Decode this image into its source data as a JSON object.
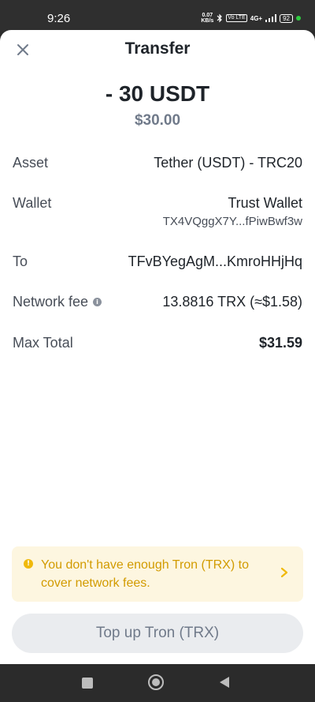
{
  "status_bar": {
    "time": "9:26",
    "net_speed_value": "0.07",
    "net_speed_unit": "KB/s",
    "vo_label": "Vo LTE",
    "signal_label": "4G+",
    "battery": "92"
  },
  "sheet": {
    "title": "Transfer",
    "amount": "- 30 USDT",
    "amount_fiat": "$30.00"
  },
  "details": {
    "asset_label": "Asset",
    "asset_value": "Tether (USDT) - TRC20",
    "wallet_label": "Wallet",
    "wallet_name": "Trust Wallet",
    "wallet_address": "TX4VQggX7Y...fPiwBwf3w",
    "to_label": "To",
    "to_value": "TFvBYegAgM...KmroHHjHq",
    "fee_label": "Network fee",
    "fee_value": "13.8816 TRX (≈$1.58)",
    "total_label": "Max Total",
    "total_value": "$31.59"
  },
  "warning": {
    "text": "You don't have enough Tron (TRX) to cover network fees."
  },
  "action": {
    "topup_label": "Top up Tron (TRX)"
  },
  "colors": {
    "accent_warning": "#f0b90b",
    "warning_text": "#d29b00",
    "warning_bg": "#fdf6e0",
    "button_disabled_bg": "#eaecef"
  }
}
